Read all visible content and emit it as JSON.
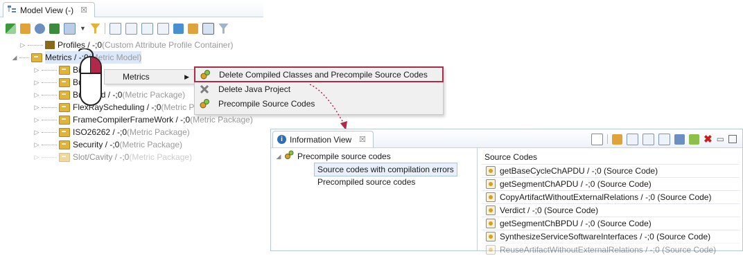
{
  "model_view": {
    "title": "Model View (-)",
    "close": "☒",
    "tree": [
      {
        "label": "Profiles / -;0",
        "suffix": " (Custom Attribute Profile Container)",
        "expanded": false,
        "indent": 0
      },
      {
        "label": "Metrics / -;0",
        "suffix": " (Metric Model)",
        "expanded": true,
        "indent": 0
      },
      {
        "label": "Bil",
        "suffix": "",
        "expanded": false,
        "indent": 1
      },
      {
        "label": "Bu",
        "suffix": "",
        "expanded": false,
        "indent": 1
      },
      {
        "label": "BusLoad / -;0",
        "suffix": " (Metric Package)",
        "expanded": false,
        "indent": 1
      },
      {
        "label": "FlexRayScheduling / -;0",
        "suffix": " (Metric P",
        "expanded": false,
        "indent": 1
      },
      {
        "label": "FrameCompilerFrameWork / -;0",
        "suffix": " (Metric Package)",
        "expanded": false,
        "indent": 1
      },
      {
        "label": "ISO26262 / -;0",
        "suffix": " (Metric Package)",
        "expanded": false,
        "indent": 1
      },
      {
        "label": "Security / -;0",
        "suffix": " (Metric Package)",
        "expanded": false,
        "indent": 1
      },
      {
        "label": "Slot/Cavity / -;0",
        "suffix": " (Metric Package)",
        "expanded": false,
        "indent": 1
      }
    ]
  },
  "context_menu": {
    "parent_label": "Metrics",
    "items": [
      {
        "label": "Delete Compiled Classes and Precompile Source Codes",
        "icon": "gears-icon"
      },
      {
        "label": "Delete Java Project",
        "icon": "delete-x-icon"
      },
      {
        "label": "Precompile Source Codes",
        "icon": "gears-icon"
      }
    ]
  },
  "info_view": {
    "title": "Information View",
    "close": "☒",
    "tree": {
      "root": "Precompile source codes",
      "children": [
        "Source codes with compilation errors",
        "Precompiled source codes"
      ]
    },
    "right_header": "Source Codes",
    "source_codes": [
      "getBaseCycleChAPDU / -;0 (Source Code)",
      "getSegmentChAPDU / -;0 (Source Code)",
      "CopyArtifactWithoutExternalRelations / -;0 (Source Code)",
      "Verdict / -;0 (Source Code)",
      "getSegmentChBPDU / -;0 (Source Code)",
      "SynthesizeServiceSoftwareInterfaces / -;0 (Source Code)",
      "ReuseArtifactWithoutExternalRelations / -;0 (Source Code)"
    ]
  },
  "colors": {
    "highlight_border": "#b0284a",
    "arrow": "#b0284a",
    "folder": "#e2b33a"
  }
}
